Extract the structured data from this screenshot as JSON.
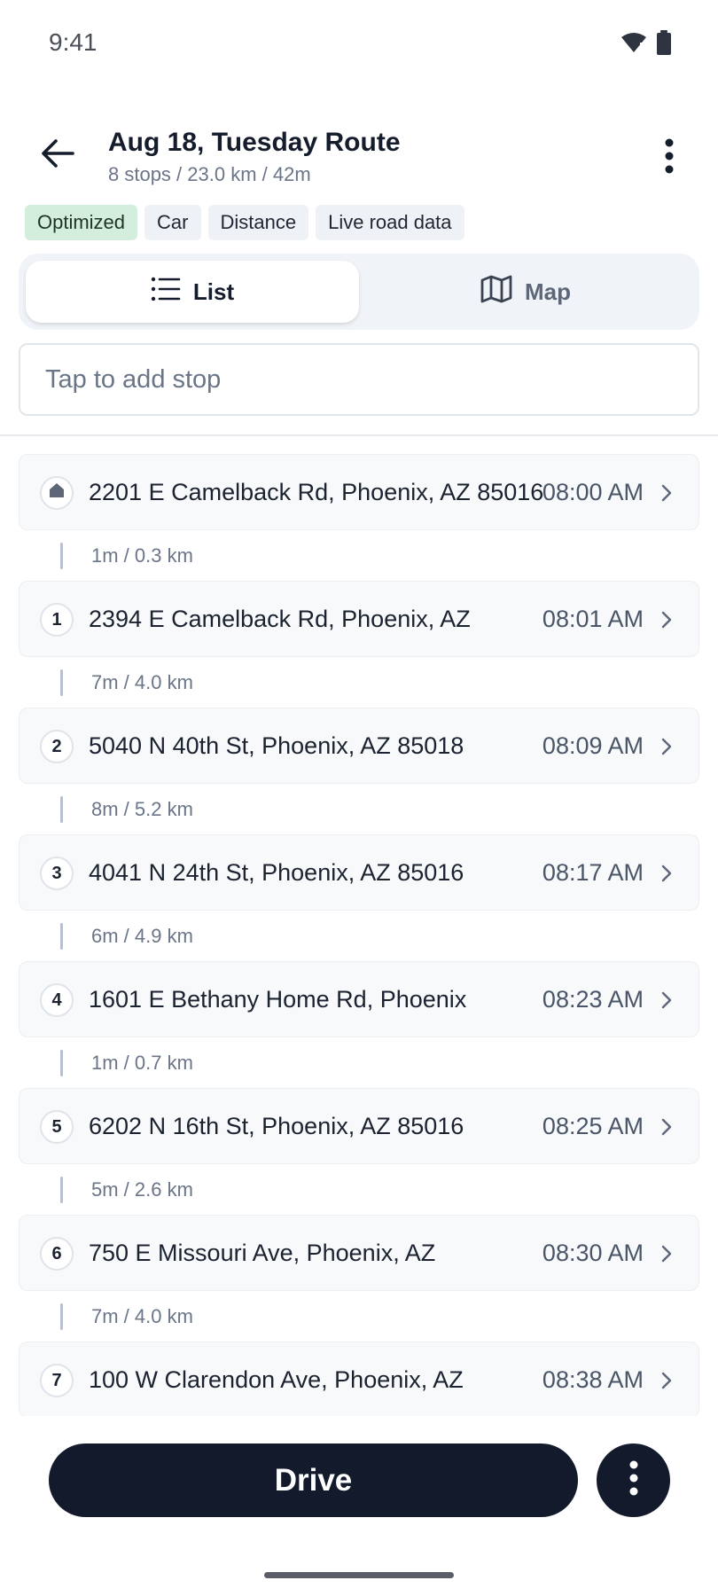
{
  "status_bar": {
    "time": "9:41",
    "icons": [
      "wifi-icon",
      "battery-icon"
    ]
  },
  "header": {
    "title": "Aug 18, Tuesday Route",
    "subtitle": "8 stops / 23.0 km / 42m"
  },
  "chips": [
    {
      "label": "Optimized",
      "active": true
    },
    {
      "label": "Car",
      "active": false
    },
    {
      "label": "Distance",
      "active": false
    },
    {
      "label": "Live road data",
      "active": false
    }
  ],
  "view_toggle": {
    "list_label": "List",
    "map_label": "Map",
    "selected": "List"
  },
  "add_stop": {
    "placeholder": "Tap to add stop"
  },
  "stops": [
    {
      "marker": "home-icon",
      "address": "2201 E Camelback Rd, Phoenix, AZ 85016",
      "time": "08:00 AM",
      "leg": "1m / 0.3 km"
    },
    {
      "marker": "1",
      "address": "2394 E Camelback Rd, Phoenix, AZ",
      "time": "08:01 AM",
      "leg": "7m / 4.0 km"
    },
    {
      "marker": "2",
      "address": "5040 N 40th St, Phoenix, AZ 85018",
      "time": "08:09 AM",
      "leg": "8m / 5.2 km"
    },
    {
      "marker": "3",
      "address": "4041 N 24th St, Phoenix, AZ 85016",
      "time": "08:17 AM",
      "leg": "6m / 4.9 km"
    },
    {
      "marker": "4",
      "address": "1601 E Bethany Home Rd, Phoenix",
      "time": "08:23 AM",
      "leg": "1m / 0.7 km"
    },
    {
      "marker": "5",
      "address": "6202 N 16th St, Phoenix, AZ 85016",
      "time": "08:25 AM",
      "leg": "5m / 2.6 km"
    },
    {
      "marker": "6",
      "address": "750 E Missouri Ave, Phoenix, AZ",
      "time": "08:30 AM",
      "leg": "7m / 4.0 km"
    },
    {
      "marker": "7",
      "address": "100 W Clarendon Ave, Phoenix, AZ",
      "time": "08:38 AM",
      "leg": ""
    }
  ],
  "bottom_bar": {
    "drive_label": "Drive"
  },
  "colors": {
    "primary_dark": "#121a2c",
    "chip_active": "#d4eedd",
    "chip": "#eef1f5",
    "muted_text": "#6b7588"
  }
}
